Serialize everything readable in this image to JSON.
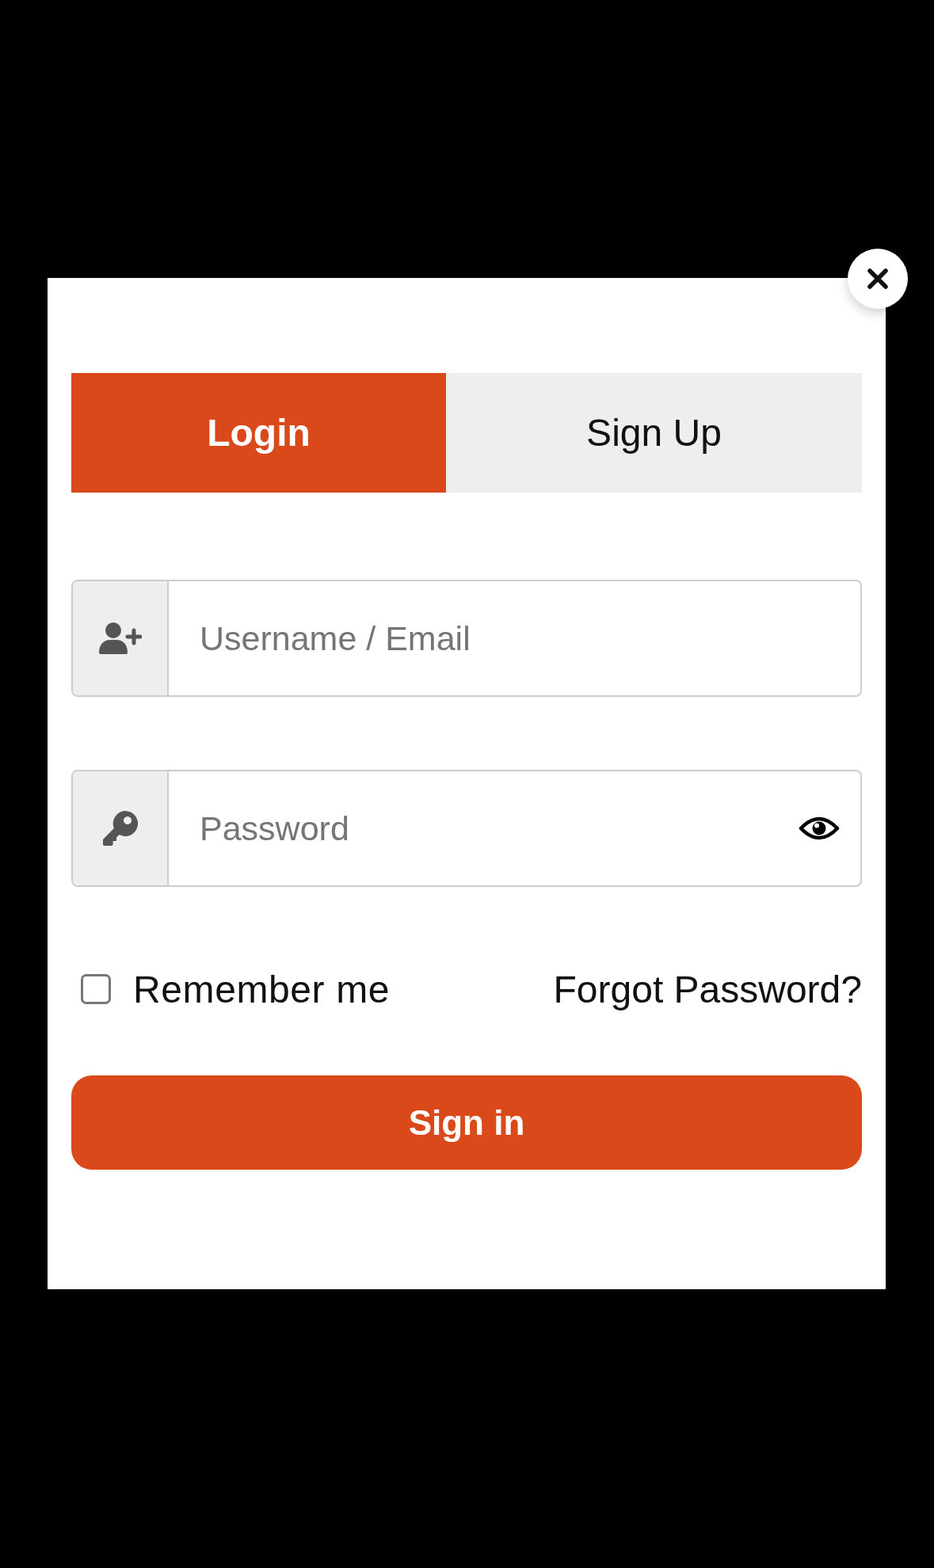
{
  "tabs": [
    {
      "label": "Login",
      "selected": true
    },
    {
      "label": "Sign Up",
      "selected": false
    }
  ],
  "fields": [
    {
      "kind": "username",
      "placeholder": "Username / Email"
    },
    {
      "kind": "password",
      "placeholder": "Password"
    }
  ],
  "remember": {
    "label": "Remember me",
    "checked": false
  },
  "forgot_link": "Forgot Password?",
  "submit": "Sign in"
}
